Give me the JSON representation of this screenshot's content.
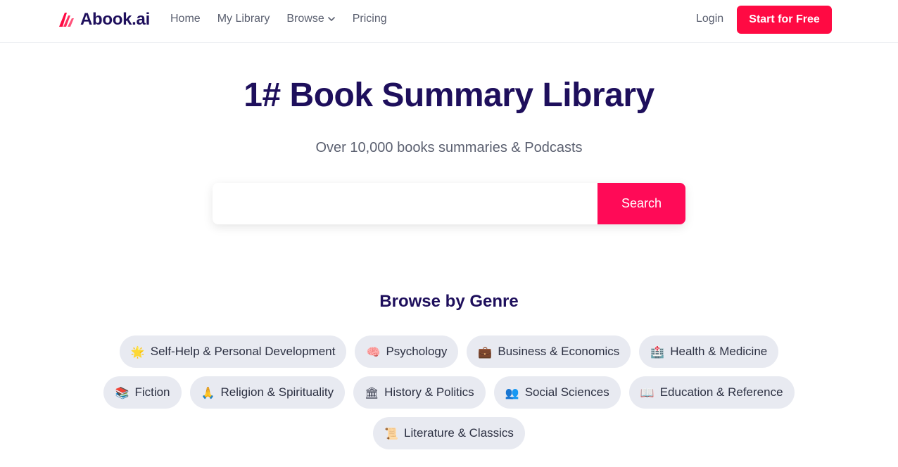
{
  "brand": {
    "name": "Abook.ai",
    "color": "#ff0a43"
  },
  "nav": {
    "items": [
      {
        "label": "Home"
      },
      {
        "label": "My Library"
      },
      {
        "label": "Browse",
        "has_dropdown": true
      },
      {
        "label": "Pricing"
      }
    ],
    "login_label": "Login",
    "cta_label": "Start for Free"
  },
  "hero": {
    "title": "1# Book Summary Library",
    "subtitle": "Over 10,000 books summaries & Podcasts"
  },
  "search": {
    "placeholder": "",
    "value": "",
    "button_label": "Search"
  },
  "genres": {
    "title": "Browse by Genre",
    "items": [
      {
        "icon": "sun-icon",
        "emoji": "🌟",
        "label": "Self-Help & Personal Development"
      },
      {
        "icon": "brain-icon",
        "emoji": "🧠",
        "label": "Psychology"
      },
      {
        "icon": "briefcase-icon",
        "emoji": "💼",
        "label": "Business & Economics"
      },
      {
        "icon": "hospital-icon",
        "emoji": "🏥",
        "label": "Health & Medicine"
      },
      {
        "icon": "books-icon",
        "emoji": "📚",
        "label": "Fiction"
      },
      {
        "icon": "praying-hands-icon",
        "emoji": "🙏",
        "label": "Religion & Spirituality"
      },
      {
        "icon": "classical-building-icon",
        "emoji": "🏛",
        "label": "History & Politics"
      },
      {
        "icon": "people-icon",
        "emoji": "👥",
        "label": "Social Sciences"
      },
      {
        "icon": "open-book-icon",
        "emoji": "📖",
        "label": "Education & Reference"
      },
      {
        "icon": "scroll-icon",
        "emoji": "📜",
        "label": "Literature & Classics"
      }
    ]
  }
}
